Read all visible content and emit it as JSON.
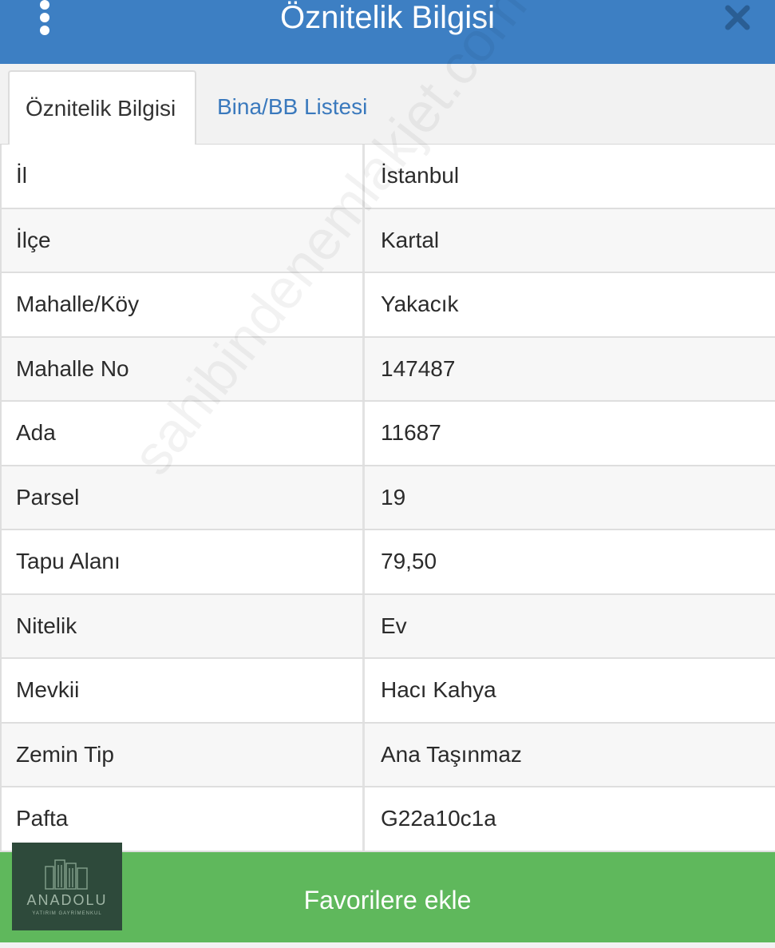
{
  "header": {
    "title": "Öznitelik Bilgisi",
    "menu_icon": "kebab-menu-icon",
    "close_icon": "close-icon",
    "background": "#3d7fc3"
  },
  "tabs": [
    {
      "label": "Öznitelik Bilgisi",
      "active": true
    },
    {
      "label": "Bina/BB Listesi",
      "active": false
    }
  ],
  "rows": [
    {
      "key": "İl",
      "value": "İstanbul"
    },
    {
      "key": "İlçe",
      "value": "Kartal"
    },
    {
      "key": "Mahalle/Köy",
      "value": "Yakacık"
    },
    {
      "key": "Mahalle No",
      "value": "147487"
    },
    {
      "key": "Ada",
      "value": "11687"
    },
    {
      "key": "Parsel",
      "value": "19"
    },
    {
      "key": "Tapu Alanı",
      "value": "79,50"
    },
    {
      "key": "Nitelik",
      "value": "Ev"
    },
    {
      "key": "Mevkii",
      "value": "Hacı Kahya"
    },
    {
      "key": "Zemin Tip",
      "value": "Ana Taşınmaz"
    },
    {
      "key": "Pafta",
      "value": "G22a10c1a"
    }
  ],
  "footer": {
    "button_label": "Favorilere ekle",
    "background": "#5fb85c"
  },
  "logo": {
    "word": "ANADOLU",
    "sub": "YATIRIM GAYRİMENKUL"
  },
  "watermark": "sahibindenemlakjet.com"
}
